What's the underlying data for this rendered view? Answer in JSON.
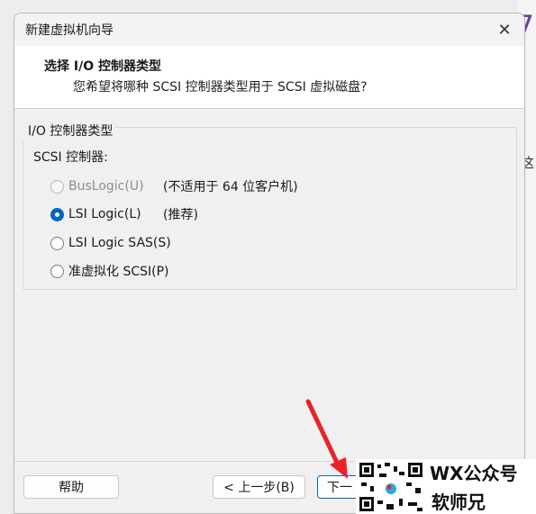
{
  "background": {
    "seven_glyph": "7",
    "partial_char": "这"
  },
  "dialog": {
    "title": "新建虚拟机向导",
    "close_icon": "✕",
    "header": {
      "title": "选择 I/O 控制器类型",
      "subtitle": "您希望将哪种 SCSI 控制器类型用于 SCSI 虚拟磁盘?"
    },
    "group": {
      "legend": "I/O 控制器类型",
      "scsi_label": "SCSI 控制器:",
      "options": [
        {
          "label": "BusLogic(U)",
          "note": "(不适用于 64 位客户机)",
          "checked": false,
          "disabled": true
        },
        {
          "label": "LSI Logic(L)",
          "note": "(推荐)",
          "checked": true,
          "disabled": false
        },
        {
          "label": "LSI Logic SAS(S)",
          "note": "",
          "checked": false,
          "disabled": false
        },
        {
          "label": "准虚拟化 SCSI(P)",
          "note": "",
          "checked": false,
          "disabled": false
        }
      ]
    },
    "buttons": {
      "help": "帮助",
      "back": "< 上一步(B)",
      "next": "下一"
    }
  },
  "overlay": {
    "arrow_color": "#e8232a",
    "watermark_line1": "WX公众号",
    "watermark_line2": "软师兄"
  },
  "colors": {
    "accent": "#0067c0",
    "brand_purple": "#6b3fa0"
  }
}
